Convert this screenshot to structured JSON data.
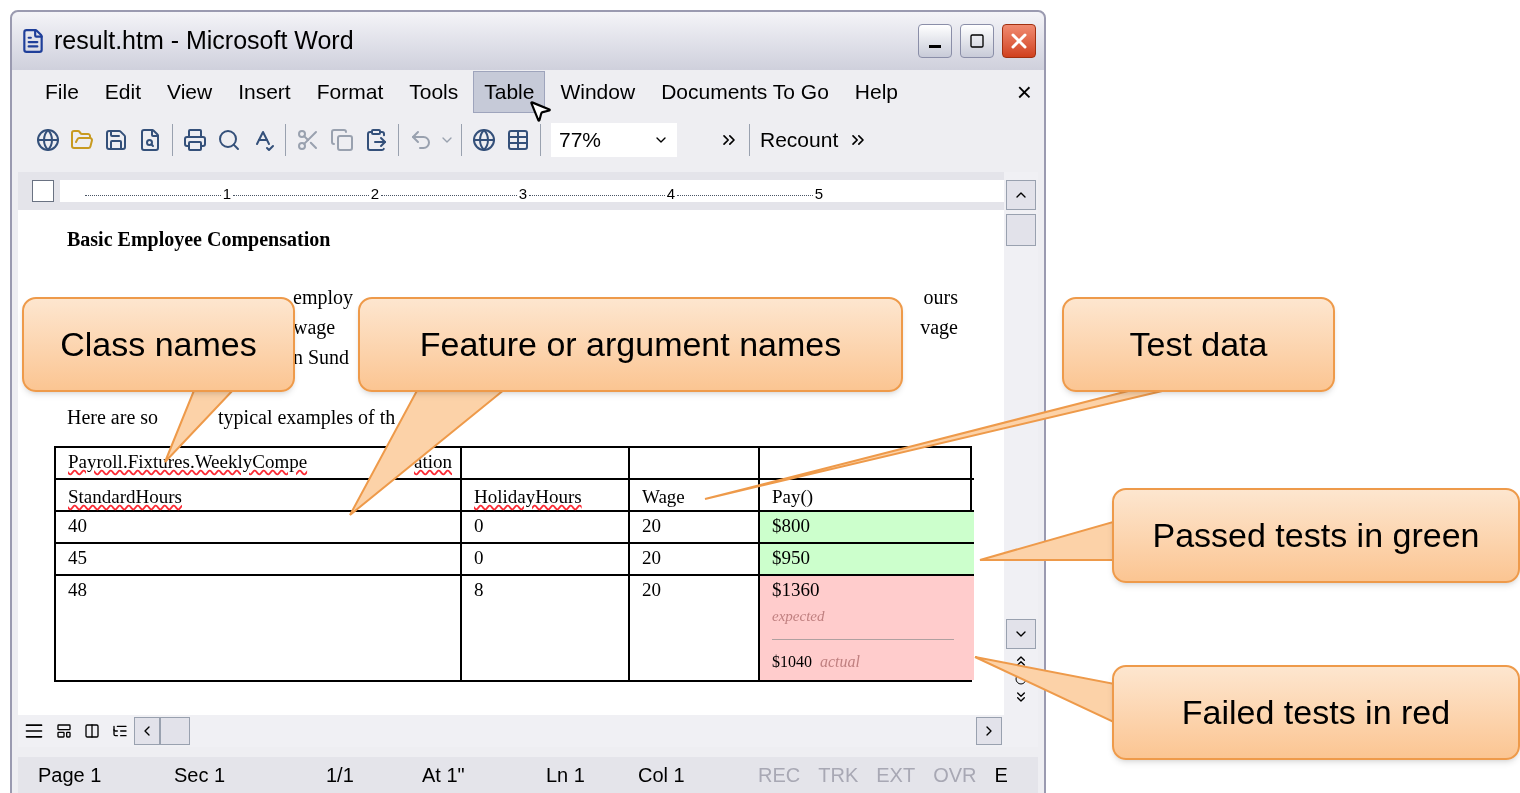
{
  "window": {
    "title": "result.htm - Microsoft Word"
  },
  "menu": [
    {
      "label": "File",
      "selected": false
    },
    {
      "label": "Edit",
      "selected": false
    },
    {
      "label": "View",
      "selected": false
    },
    {
      "label": "Insert",
      "selected": false
    },
    {
      "label": "Format",
      "selected": false
    },
    {
      "label": "Tools",
      "selected": false
    },
    {
      "label": "Table",
      "selected": true
    },
    {
      "label": "Window",
      "selected": false
    },
    {
      "label": "Documents To Go",
      "selected": false
    },
    {
      "label": "Help",
      "selected": false
    }
  ],
  "menu_close": "×",
  "toolbar": {
    "zoom": "77%",
    "recount": "Recount"
  },
  "ruler": [
    "1",
    "2",
    "3",
    "4",
    "5"
  ],
  "document": {
    "heading": "Basic Employee Compensation",
    "paragraph_lines": [
      [
        "employ",
        "ours"
      ],
      [
        "wage",
        "vage"
      ],
      [
        "n Sund"
      ]
    ],
    "intro": [
      "Here are so",
      "typical examples of th"
    ],
    "table": {
      "title": [
        "Payroll.Fixtures.WeeklyCompe",
        "ation"
      ],
      "columns": [
        "StandardHours",
        "HolidayHours",
        "Wage",
        "Pay()"
      ],
      "rows": [
        {
          "cells": [
            "40",
            "0",
            "20",
            "$800"
          ],
          "passed": true
        },
        {
          "cells": [
            "45",
            "0",
            "20",
            "$950"
          ],
          "passed": true
        },
        {
          "cells": [
            "48",
            "8",
            "20",
            "$1360"
          ],
          "passed": false,
          "expected_label": "expected",
          "actual": "$1040",
          "actual_label": "actual"
        }
      ]
    }
  },
  "status_bar": {
    "fields": [
      "Page 1",
      "Sec 1",
      "1/1",
      "At 1\"",
      "Ln 1",
      "Col 1"
    ],
    "indicators": [
      {
        "label": "REC",
        "disabled": true
      },
      {
        "label": "TRK",
        "disabled": true
      },
      {
        "label": "EXT",
        "disabled": true
      },
      {
        "label": "OVR",
        "disabled": true
      },
      {
        "label": "E",
        "disabled": false
      }
    ]
  },
  "callouts": [
    {
      "text": "Class names"
    },
    {
      "text": "Feature or argument names"
    },
    {
      "text": "Test data"
    },
    {
      "text": "Passed tests in green"
    },
    {
      "text": "Failed tests in red"
    }
  ]
}
